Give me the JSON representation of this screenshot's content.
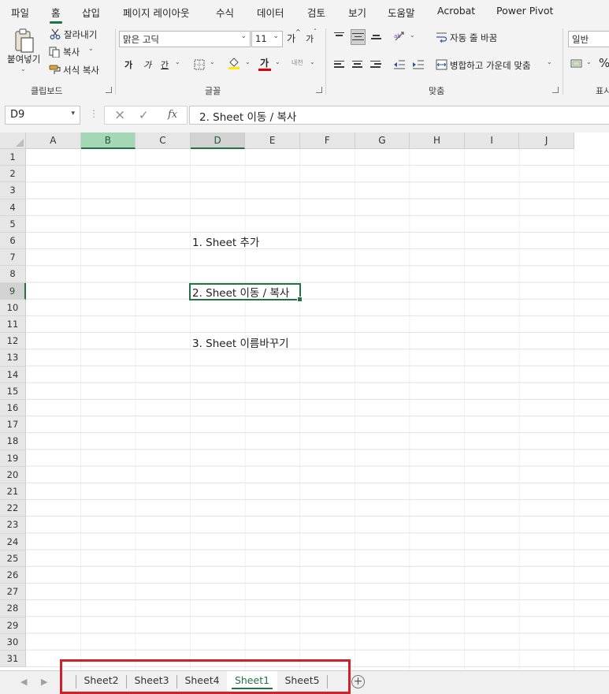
{
  "menu": {
    "items": [
      "파일",
      "홈",
      "삽입",
      "페이지 레이아웃",
      "수식",
      "데이터",
      "검토",
      "보기",
      "도움말",
      "Acrobat",
      "Power Pivot"
    ],
    "active": "홈"
  },
  "ribbon": {
    "clipboard": {
      "paste_label": "붙여넣기",
      "cut_label": "잘라내기",
      "copy_label": "복사",
      "format_painter_label": "서식 복사",
      "group_label": "클립보드"
    },
    "font": {
      "font_name": "맑은 고딕",
      "font_size": "11",
      "grow_label": "가",
      "shrink_label": "가",
      "bold_label": "가",
      "italic_label": "가",
      "underline_label": "간",
      "font_color_label": "가",
      "phonetic_label": "내천",
      "group_label": "글꼴"
    },
    "alignment": {
      "wrap_text_label": "자동 줄 바꿈",
      "merge_center_label": "병합하고 가운데 맞춤",
      "group_label": "맞춤"
    },
    "number": {
      "format_value": "일반",
      "group_label": "표시"
    }
  },
  "formula_bar": {
    "name_box": "D9",
    "fx_label": "fx",
    "content": "2. Sheet 이동 / 복사"
  },
  "grid": {
    "columns": [
      "A",
      "B",
      "C",
      "D",
      "E",
      "F",
      "G",
      "H",
      "I",
      "J"
    ],
    "rows": [
      "1",
      "2",
      "3",
      "4",
      "5",
      "6",
      "7",
      "8",
      "9",
      "10",
      "11",
      "12",
      "13",
      "14",
      "15",
      "16",
      "17",
      "18",
      "19",
      "20",
      "21",
      "22",
      "23",
      "24",
      "25",
      "26",
      "27",
      "28",
      "29",
      "30",
      "31"
    ],
    "selected_column": "D",
    "highlighted_column": "B",
    "selected_row": "9",
    "cells": {
      "D6": "1. Sheet 추가",
      "D9": "2. Sheet 이동 / 복사",
      "D12": "3. Sheet 이름바꾸기"
    }
  },
  "sheet_tabs": {
    "tabs": [
      "Sheet2",
      "Sheet3",
      "Sheet4",
      "Sheet1",
      "Sheet5"
    ],
    "active": "Sheet1"
  },
  "colors": {
    "accent": "#217346",
    "highlight_box": "#d0202a",
    "column_b_fill": "#a5d6b5"
  }
}
